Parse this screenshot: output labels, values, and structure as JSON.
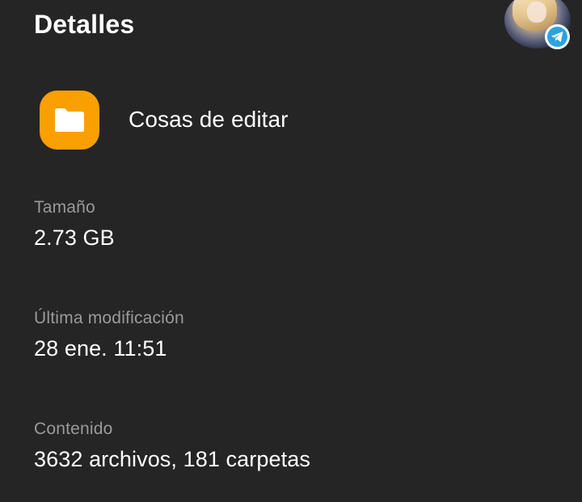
{
  "header": {
    "title": "Detalles"
  },
  "folder": {
    "name": "Cosas de editar",
    "icon": "folder-icon",
    "icon_color": "#f9a000"
  },
  "details": {
    "size": {
      "label": "Tamaño",
      "value": "2.73 GB"
    },
    "modified": {
      "label": "Última modificación",
      "value": "28 ene. 11:51"
    },
    "contents": {
      "label": "Contenido",
      "value": "3632 archivos, 181 carpetas"
    }
  },
  "overlay": {
    "avatar": "avatar-image",
    "badge_icon": "telegram-icon",
    "badge_color": "#2aa3e0"
  },
  "colors": {
    "background": "#252525",
    "primary_text": "#ffffff",
    "secondary_text": "#9a9a9a"
  }
}
